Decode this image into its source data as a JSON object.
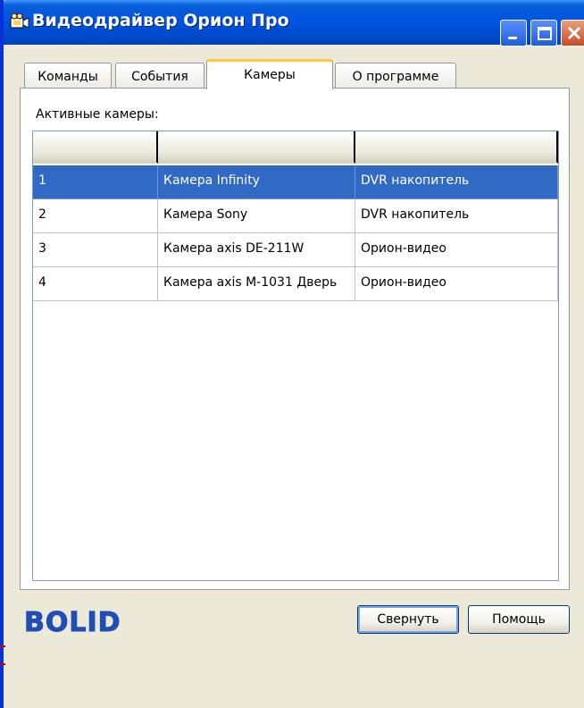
{
  "window": {
    "title": "Видеодрайвер Орион Про",
    "controls": {
      "minimize_icon": "minimize-icon",
      "maximize_icon": "maximize-icon",
      "close_icon": "close-icon"
    }
  },
  "tabs": [
    {
      "label": "Команды",
      "active": false
    },
    {
      "label": "События",
      "active": false
    },
    {
      "label": "Камеры",
      "active": true
    },
    {
      "label": "О программе",
      "active": false
    }
  ],
  "cameras": {
    "label": "Активные камеры:",
    "columns": [
      "",
      "",
      ""
    ],
    "rows": [
      {
        "num": "1",
        "name": "Камера Infinity",
        "type": "DVR накопитель",
        "selected": true
      },
      {
        "num": "2",
        "name": "Камера Sony",
        "type": "DVR накопитель",
        "selected": false
      },
      {
        "num": "3",
        "name": "Камера axis DE-211W",
        "type": "Орион-видео",
        "selected": false
      },
      {
        "num": "4",
        "name": "Камера axis M-1031 Дверь",
        "type": "Орион-видео",
        "selected": false
      }
    ]
  },
  "footer": {
    "logo_text": "BOLID",
    "collapse_label": "Свернуть",
    "help_label": "Помощь"
  },
  "colors": {
    "titlebar": "#0054e3",
    "selection": "#316ac5",
    "active_tab_accent": "#ffc83c",
    "logo": "#1f4fb4"
  }
}
